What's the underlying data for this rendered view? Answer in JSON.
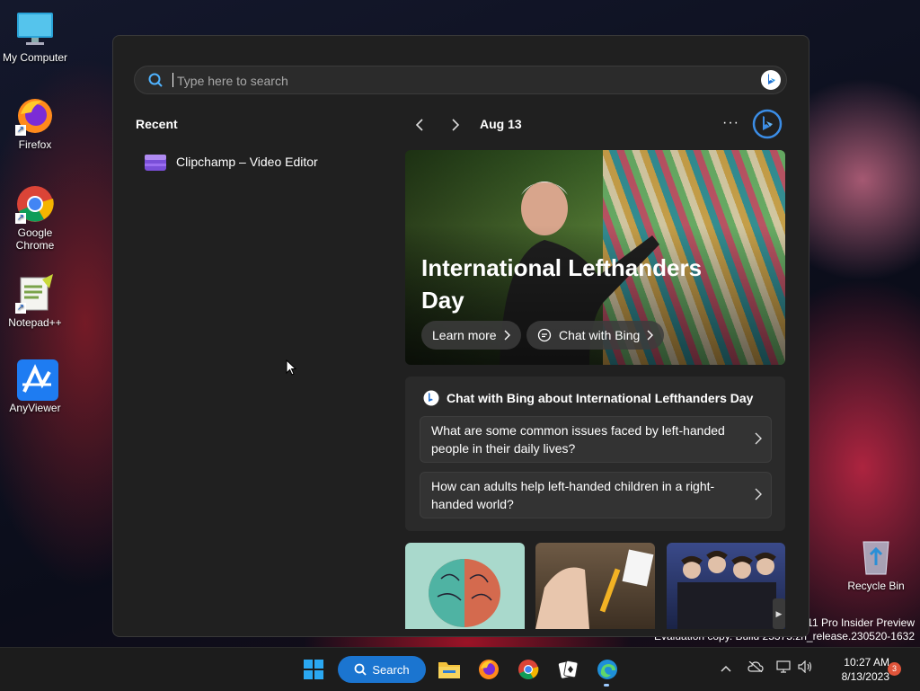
{
  "desktop": {
    "icons": [
      {
        "label": "My Computer"
      },
      {
        "label": "Firefox"
      },
      {
        "label": "Google Chrome"
      },
      {
        "label": "Notepad++"
      },
      {
        "label": "AnyViewer"
      }
    ],
    "recycle_bin": "Recycle Bin",
    "watermark_line1": "s 11 Pro Insider Preview",
    "watermark_line2": "Evaluation copy. Build 25375.zn_release.230520-1632"
  },
  "search_panel": {
    "placeholder": "Type here to search",
    "recent_title": "Recent",
    "recent_items": [
      {
        "label": "Clipchamp – Video Editor",
        "icon": "clipchamp-icon"
      }
    ],
    "date": "Aug 13",
    "more_label": "···",
    "hero": {
      "title": "International Lefthanders Day",
      "learn_more": "Learn more",
      "chat_with_bing": "Chat with Bing"
    },
    "chat_card": {
      "title": "Chat with Bing about International Lefthanders Day",
      "questions": [
        "What are some common issues faced by left-handed people in their daily lives?",
        "How can adults help left-handed children in a right-handed world?"
      ]
    }
  },
  "taskbar": {
    "search_label": "Search",
    "time": "10:27 AM",
    "date": "8/13/2023",
    "notification_count": "3",
    "accent": "#1b75d0"
  }
}
